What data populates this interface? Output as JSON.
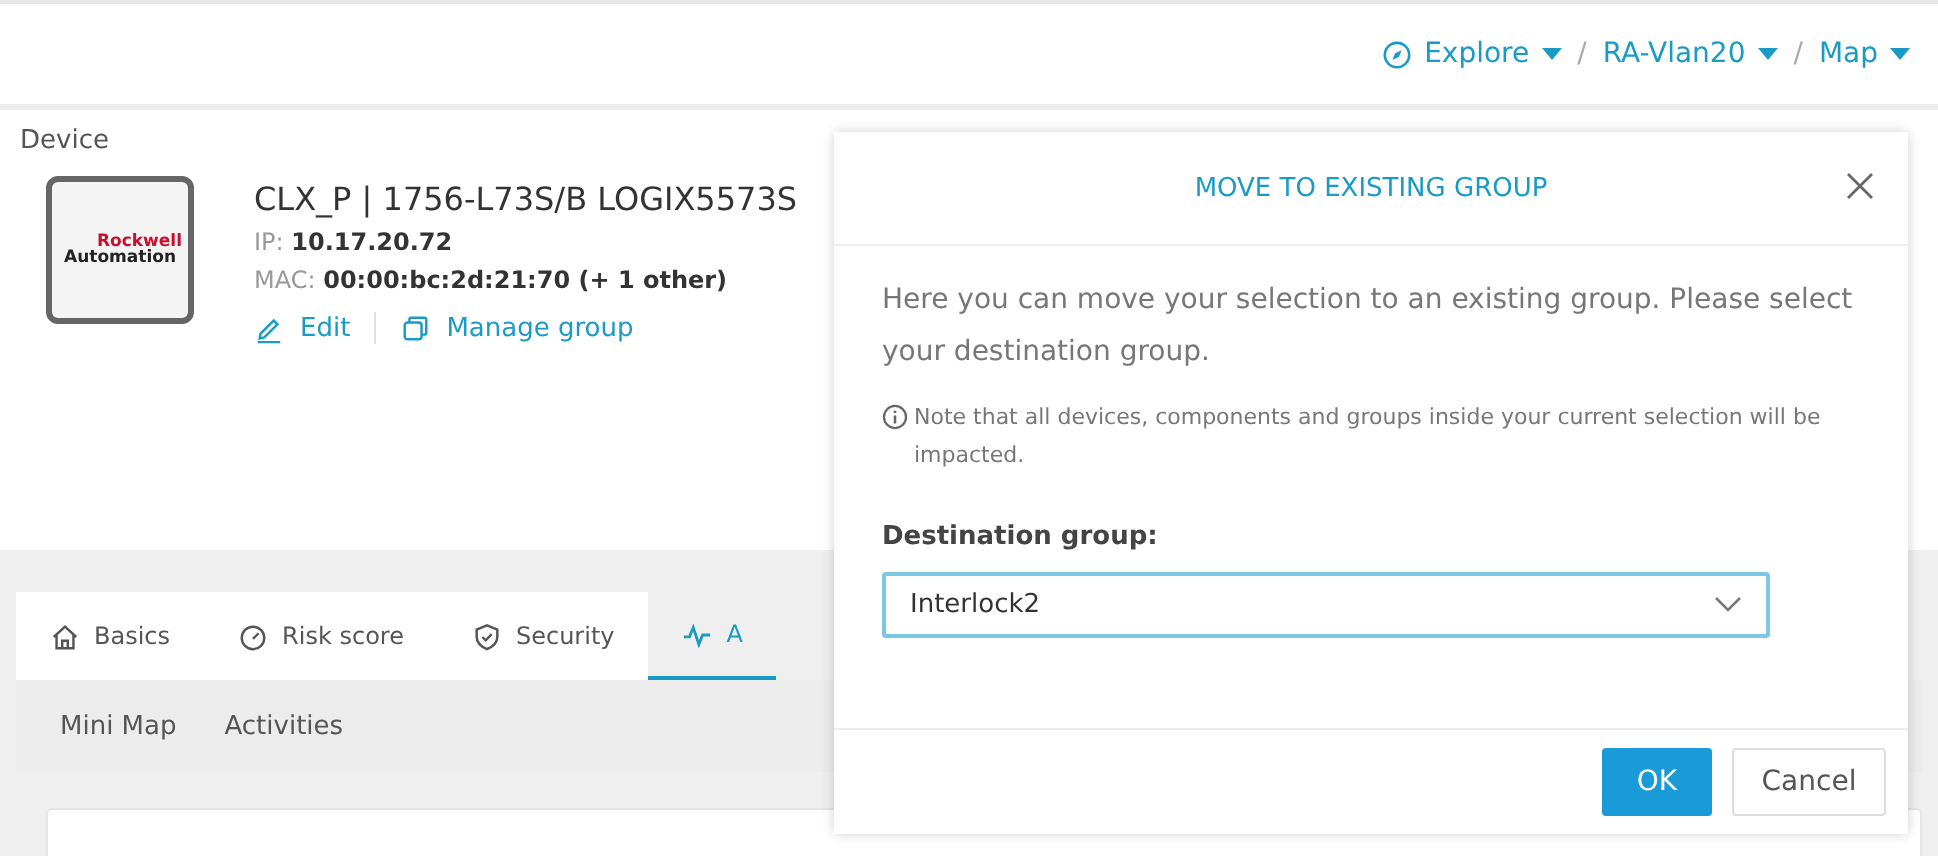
{
  "breadcrumb": [
    {
      "label": "Explore",
      "separator": "/"
    },
    {
      "label": "RA-Vlan20",
      "separator": "/"
    },
    {
      "label": "Map"
    }
  ],
  "device": {
    "section_label": "Device",
    "logo": {
      "line1": "Rockwell",
      "line2": "Automation"
    },
    "title": "CLX_P | 1756-L73S/B LOGIX5573S",
    "ip_label": "IP:",
    "ip": "10.17.20.72",
    "mac_label": "MAC:",
    "mac": "00:00:bc:2d:21:70 (+ 1 other)",
    "actions": [
      {
        "label": "Edit"
      },
      {
        "label": "Manage group"
      }
    ]
  },
  "tabs": [
    {
      "label": "Basics",
      "selected": false
    },
    {
      "label": "Risk score",
      "selected": false
    },
    {
      "label": "Security",
      "selected": false
    },
    {
      "label": "A",
      "selected": true
    }
  ],
  "subtabs": [
    {
      "label": "Mini Map"
    },
    {
      "label": "Activities"
    }
  ],
  "dialog": {
    "title": "MOVE TO EXISTING GROUP",
    "intro": "Here you can move your selection to an existing group. Please select your destination group.",
    "note": "Note that all devices, components and groups inside your current selection will be impacted.",
    "field_label": "Destination group:",
    "field_value": "Interlock2",
    "buttons": [
      {
        "label": "OK",
        "kind": "primary"
      },
      {
        "label": "Cancel",
        "kind": "secondary"
      }
    ]
  }
}
